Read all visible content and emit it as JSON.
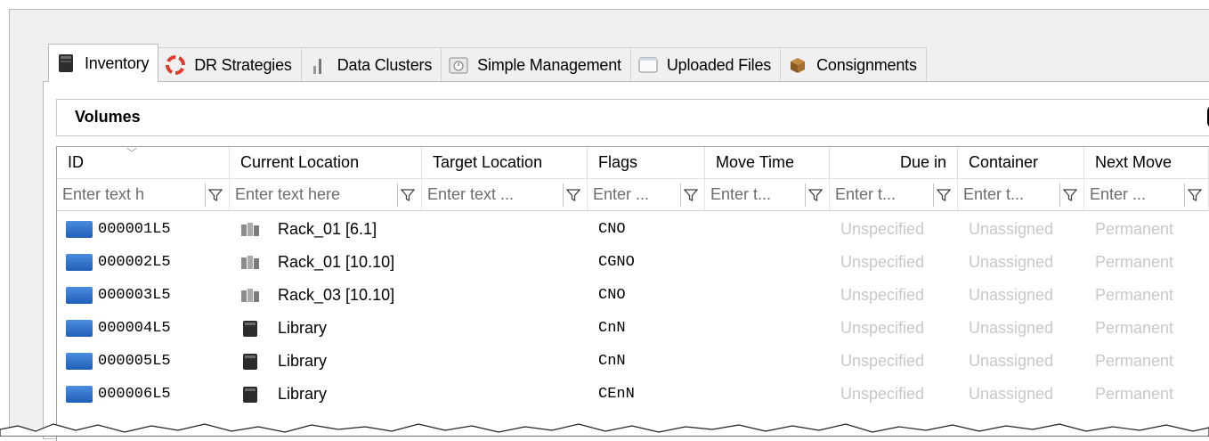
{
  "tabs": [
    {
      "label": "Inventory",
      "icon": "library-icon",
      "active": true
    },
    {
      "label": "DR Strategies",
      "icon": "lifebuoy-icon",
      "active": false
    },
    {
      "label": "Data Clusters",
      "icon": "clusters-icon",
      "active": false
    },
    {
      "label": "Simple Management",
      "icon": "clock-icon",
      "active": false
    },
    {
      "label": "Uploaded Files",
      "icon": "window-icon",
      "active": false
    },
    {
      "label": "Consignments",
      "icon": "box-icon",
      "active": false
    }
  ],
  "section": {
    "title": "Volumes"
  },
  "columns": [
    {
      "label": "ID",
      "placeholder": "Enter text h"
    },
    {
      "label": "Current Location",
      "placeholder": "Enter text here"
    },
    {
      "label": "Target Location",
      "placeholder": "Enter text ..."
    },
    {
      "label": "Flags",
      "placeholder": "Enter ..."
    },
    {
      "label": "Move Time",
      "placeholder": "Enter t..."
    },
    {
      "label": "Due in",
      "placeholder": "Enter t..."
    },
    {
      "label": "Container",
      "placeholder": "Enter t..."
    },
    {
      "label": "Next Move",
      "placeholder": "Enter ..."
    }
  ],
  "rows": [
    {
      "id": "000001L5",
      "current_location": "Rack_01 [6.1]",
      "location_icon": "rack-icon",
      "target_location": "",
      "flags": "CNO",
      "move_time": "",
      "due_in": "Unspecified",
      "container": "Unassigned",
      "next_move": "Permanent"
    },
    {
      "id": "000002L5",
      "current_location": "Rack_01 [10.10]",
      "location_icon": "rack-icon",
      "target_location": "",
      "flags": "CGNO",
      "move_time": "",
      "due_in": "Unspecified",
      "container": "Unassigned",
      "next_move": "Permanent"
    },
    {
      "id": "000003L5",
      "current_location": "Rack_03 [10.10]",
      "location_icon": "rack-icon",
      "target_location": "",
      "flags": "CNO",
      "move_time": "",
      "due_in": "Unspecified",
      "container": "Unassigned",
      "next_move": "Permanent"
    },
    {
      "id": "000004L5",
      "current_location": "Library",
      "location_icon": "library-icon",
      "target_location": "",
      "flags": "CnN",
      "move_time": "",
      "due_in": "Unspecified",
      "container": "Unassigned",
      "next_move": "Permanent"
    },
    {
      "id": "000005L5",
      "current_location": "Library",
      "location_icon": "library-icon",
      "target_location": "",
      "flags": "CnN",
      "move_time": "",
      "due_in": "Unspecified",
      "container": "Unassigned",
      "next_move": "Permanent"
    },
    {
      "id": "000006L5",
      "current_location": "Library",
      "location_icon": "library-icon",
      "target_location": "",
      "flags": "CEnN",
      "move_time": "",
      "due_in": "Unspecified",
      "container": "Unassigned",
      "next_move": "Permanent"
    }
  ],
  "colors": {
    "tape": "#2f74cf",
    "dim_text": "#c8c8c8",
    "lifebuoy": "#e23a2c"
  }
}
